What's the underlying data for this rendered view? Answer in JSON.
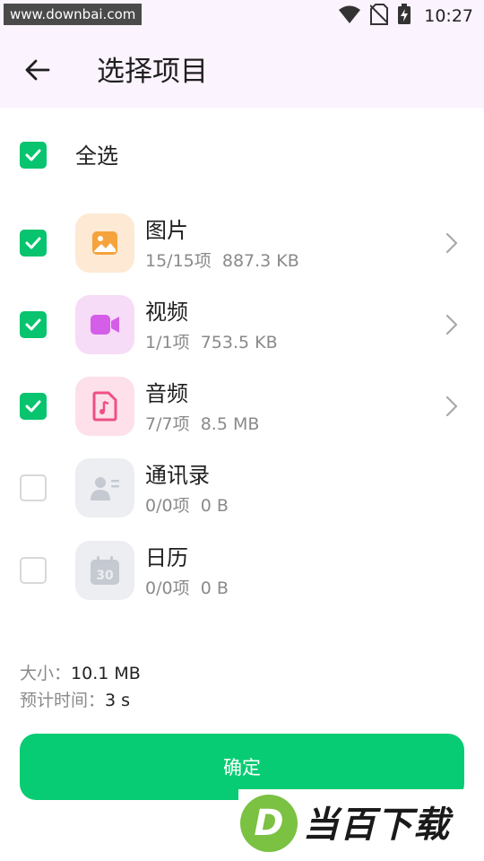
{
  "status_bar": {
    "watermark": "www.downbai.com",
    "time": "10:27"
  },
  "header": {
    "title": "选择项目"
  },
  "select_all": {
    "label": "全选",
    "checked": true
  },
  "items": [
    {
      "name": "图片",
      "count": "15/15项",
      "size": "887.3 KB",
      "checked": true,
      "icon": "image-icon",
      "icon_bg": "#fde9d4",
      "icon_color": "#f5a33c",
      "has_arrow": true
    },
    {
      "name": "视频",
      "count": "1/1项",
      "size": "753.5 KB",
      "checked": true,
      "icon": "video-icon",
      "icon_bg": "#f7dcf7",
      "icon_color": "#d45ee8",
      "has_arrow": true
    },
    {
      "name": "音频",
      "count": "7/7项",
      "size": "8.5 MB",
      "checked": true,
      "icon": "audio-file-icon",
      "icon_bg": "#fde0e9",
      "icon_color": "#ee4f86",
      "has_arrow": true
    },
    {
      "name": "通讯录",
      "count": "0/0项",
      "size": "0 B",
      "checked": false,
      "icon": "contacts-icon",
      "icon_bg": "#eceef2",
      "icon_color": "#c5c9d1",
      "has_arrow": false
    },
    {
      "name": "日历",
      "count": "0/0项",
      "size": "0 B",
      "checked": false,
      "icon": "calendar-icon",
      "icon_bg": "#eceef2",
      "icon_color": "#c5c9d1",
      "has_arrow": false
    }
  ],
  "summary": {
    "size_label": "大小：",
    "size_value": "10.1 MB",
    "time_label": "预计时间：",
    "time_value": "3 s"
  },
  "confirm_button": {
    "label": "确定"
  },
  "watermark_bottom": {
    "logo_letter": "D",
    "text": "当百下载"
  },
  "colors": {
    "accent": "#08cc73",
    "checkbox": "#08c46e",
    "header_bg": "#fbf3fd"
  }
}
